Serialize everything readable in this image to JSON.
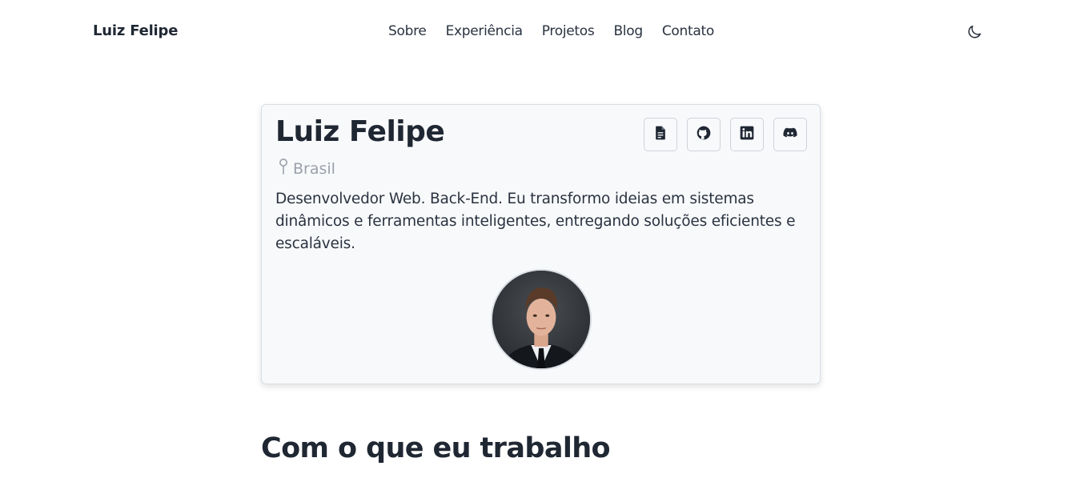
{
  "header": {
    "brand": "Luiz Felipe",
    "nav": [
      {
        "label": "Sobre"
      },
      {
        "label": "Experiência"
      },
      {
        "label": "Projetos"
      },
      {
        "label": "Blog"
      },
      {
        "label": "Contato"
      }
    ],
    "theme_toggle_icon": "moon-icon"
  },
  "profile": {
    "name": "Luiz Felipe",
    "location": "Brasil",
    "location_icon": "map-pin-icon",
    "bio": "Desenvolvedor Web. Back-End. Eu transformo ideias em sistemas dinâmicos e ferramentas inteligentes, entregando soluções eficientes e escaláveis.",
    "links": [
      {
        "icon": "resume-document-icon"
      },
      {
        "icon": "github-icon"
      },
      {
        "icon": "linkedin-icon"
      },
      {
        "icon": "discord-icon"
      }
    ]
  },
  "sections": {
    "skills_heading": "Com o que eu trabalho"
  },
  "colors": {
    "text": "#1f2733",
    "muted": "#9aa1ab",
    "card_bg": "#f8f9fb",
    "border": "#d9dde3"
  }
}
